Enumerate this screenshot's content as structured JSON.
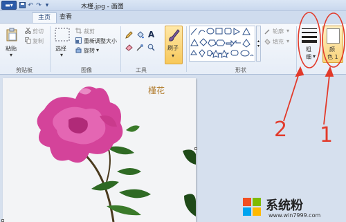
{
  "window": {
    "title": "木槿.jpg - 画图"
  },
  "tabs": [
    {
      "label": "主页",
      "active": true
    },
    {
      "label": "查看",
      "active": false
    }
  ],
  "ribbon": {
    "clipboard": {
      "paste": "粘贴",
      "cut": "剪切",
      "copy": "复制",
      "group": "剪贴板"
    },
    "image": {
      "select": "选择",
      "crop": "裁剪",
      "resize": "重新调整大小",
      "rotate": "旋转",
      "group": "图像"
    },
    "tools": {
      "group": "工具",
      "text_icon": "A"
    },
    "brush": {
      "label": "刷子"
    },
    "shapes": {
      "outline": "轮廓",
      "fill": "填充",
      "group": "形状"
    },
    "size": {
      "label_line1": "粗",
      "label_line2": "细"
    },
    "color1": {
      "label_line1": "颜",
      "label_line2": "色 1"
    }
  },
  "canvas": {
    "image_text": "槿花"
  },
  "annotations": {
    "num_2": "2",
    "num_1": "1",
    "color": "#e23a2a"
  },
  "watermark": {
    "text": "系统粉",
    "url": "www.win7999.com"
  }
}
